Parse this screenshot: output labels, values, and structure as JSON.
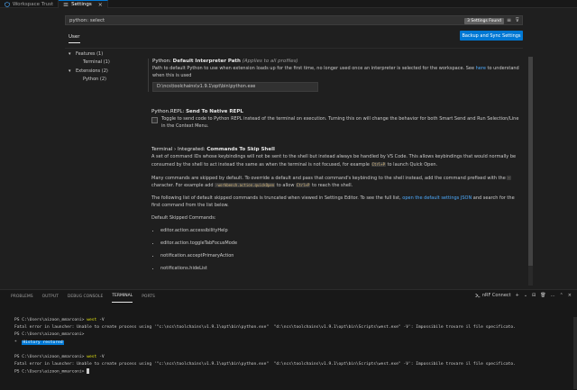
{
  "tabs": [
    {
      "label": "Workspace Trust",
      "icon": "shield-icon"
    },
    {
      "label": "Settings",
      "icon": "settings-icon",
      "close": "×"
    }
  ],
  "search": {
    "value": "python: select",
    "found": "3 Settings Found",
    "clear_icon": "≡",
    "filter_icon": "⊽"
  },
  "scope": {
    "user_tab": "User",
    "sync_button": "Backup and Sync Settings"
  },
  "toc": [
    {
      "chev": "▾",
      "label": "Features (1)",
      "indent": 0
    },
    {
      "chev": "",
      "label": "Terminal (1)",
      "indent": 1
    },
    {
      "chev": "▾",
      "label": "Extensions (2)",
      "indent": 0
    },
    {
      "chev": "",
      "label": "Python (2)",
      "indent": 1
    }
  ],
  "settings": {
    "interpreter": {
      "category": "Python:",
      "name": "Default Interpreter Path",
      "scope_note": "(Applies to all profiles)",
      "desc_a": "Path to default Python to use when extension loads up for the first time, no longer used once an interpreter is selected for the workspace. See ",
      "link": "here",
      "desc_b": " to understand when this is used",
      "value": "D:\\ncs\\toolchains\\v1.9.1\\opt\\bin\\python.exe"
    },
    "repl": {
      "category": "Python.REPL:",
      "name": "Send To Native REPL",
      "desc": "Toggle to send code to Python REPL instead of the terminal on execution. Turning this on will change the behavior for both Smart Send and Run Selection/Line in the Context Menu."
    },
    "terminal": {
      "category": "Terminal › Integrated:",
      "name": "Commands To Skip Shell",
      "p1_a": "A set of command IDs whose keybindings will not be sent to the shell but instead always be handled by VS Code. This allows keybindings that would normally be consumed by the shell to act instead the same as when the terminal is not focused, for example ",
      "p1_code": "Ctrl+P",
      "p1_b": " to launch Quick Open.",
      "p2_a": "Many commands are skipped by default. To override a default and pass that command's keybinding to the shell instead, add the command prefixed with the ",
      "p2_code1": "-",
      "p2_b": " character. For example add ",
      "p2_code2": "-workbench.action.quickOpen",
      "p2_c": " to allow ",
      "p2_code3": "Ctrl+P",
      "p2_d": " to reach the shell.",
      "p3_a": "The following list of default skipped commands is truncated when viewed in Settings Editor. To see the full list, ",
      "p3_link": "open the default settings JSON",
      "p3_b": " and search for the first command from the list below.",
      "p4": "Default Skipped Commands:",
      "commands": [
        "editor.action.accessibilityHelp",
        "editor.action.toggleTabFocusMode",
        "notification.acceptPrimaryAction",
        "notifications.hideList"
      ]
    }
  },
  "panel": {
    "tabs": [
      "PROBLEMS",
      "OUTPUT",
      "DEBUG CONSOLE",
      "TERMINAL",
      "PORTS"
    ],
    "active_tab": "TERMINAL",
    "connect_label": "nRF Connect",
    "actions": [
      "+",
      "⌄",
      "⊟",
      "🗑",
      "…",
      "⌃",
      "×"
    ]
  },
  "terminal": {
    "prompt": "PS C:\\Users\\aizoon_mmarconi>",
    "cmd": "west",
    "arg": "-V",
    "error": "Fatal error in launcher: Unable to create process using '\"c:\\ncs\\toolchains\\v1.9.1\\opt\\bin\\python.exe\"  \"d:\\ncs\\toolchains\\v1.9.1\\opt\\bin\\Scripts\\west.exe\" -V': Impossibile trovare il file specificato.",
    "history_star": "*",
    "history": "History restored"
  }
}
